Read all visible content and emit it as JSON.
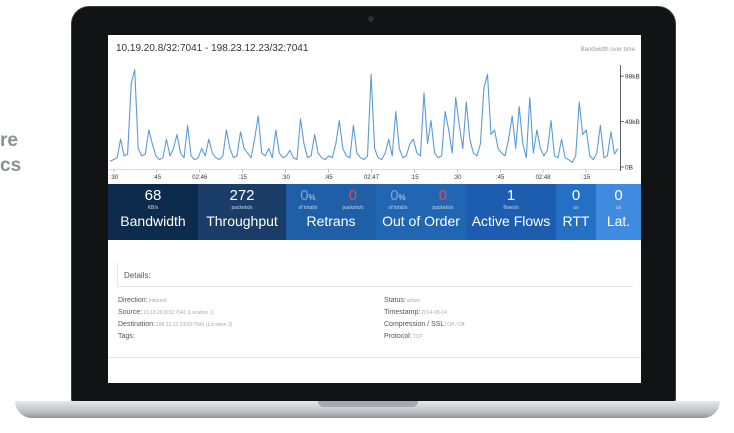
{
  "side_text": [
    "re",
    "cs"
  ],
  "header": {
    "connection": "10.19.20.8/32:7041 - 198.23.12.23/32:7041",
    "caption": "Bandwidth over time"
  },
  "chart_data": {
    "type": "line",
    "title": "Bandwidth over time",
    "x_tick_labels": [
      ":30",
      ":45",
      "02:46",
      ":15",
      ":30",
      ":45",
      "02:47",
      ":15",
      ":30",
      ":45",
      "02:48",
      ":15"
    ],
    "y_tick_labels": [
      "98kB",
      "49kB",
      "0B"
    ],
    "ylim": [
      0,
      110
    ],
    "y_unit": "kB",
    "series": [
      {
        "color": "#5b9bd9",
        "values": [
          6,
          8,
          10,
          30,
          12,
          14,
          90,
          105,
          20,
          12,
          14,
          40,
          25,
          12,
          8,
          10,
          30,
          12,
          20,
          35,
          15,
          10,
          45,
          12,
          8,
          10,
          20,
          12,
          30,
          15,
          10,
          8,
          12,
          40,
          20,
          10,
          12,
          38,
          20,
          15,
          10,
          30,
          55,
          15,
          12,
          20,
          10,
          40,
          15,
          10,
          12,
          18,
          10,
          8,
          52,
          25,
          10,
          12,
          35,
          15,
          10,
          8,
          12,
          10,
          25,
          50,
          20,
          12,
          10,
          45,
          15,
          10,
          8,
          12,
          100,
          20,
          10,
          8,
          15,
          30,
          12,
          60,
          20,
          10,
          12,
          25,
          30,
          15,
          12,
          80,
          25,
          50,
          15,
          10,
          12,
          60,
          40,
          15,
          75,
          45,
          20,
          70,
          30,
          15,
          12,
          25,
          85,
          100,
          35,
          40,
          20,
          15,
          12,
          30,
          55,
          20,
          65,
          25,
          10,
          75,
          15,
          40,
          20,
          12,
          18,
          50,
          12,
          10,
          30,
          10,
          8,
          5,
          12,
          70,
          35,
          40,
          12,
          8,
          15,
          45,
          10,
          12,
          38,
          14,
          20
        ]
      }
    ]
  },
  "metrics": {
    "bandwidth": {
      "value": "68",
      "unit": "KB/s",
      "label": "Bandwidth"
    },
    "throughput": {
      "value": "272",
      "unit": "packets/s",
      "label": "Throughput"
    },
    "retrans": {
      "value_a": "0",
      "unit_a_sym": "%",
      "unit_a": "of total/s",
      "value_b": "0",
      "unit_b": "packets/s",
      "label": "Retrans"
    },
    "out_of_order": {
      "value_a": "0",
      "unit_a_sym": "%",
      "unit_a": "of total/s",
      "value_b": "0",
      "unit_b": "packets/s",
      "label": "Out of Order"
    },
    "active_flows": {
      "value": "1",
      "unit": "flows/s",
      "label": "Active Flows"
    },
    "rtt": {
      "value": "0",
      "unit": "us",
      "label": "RTT"
    },
    "latency": {
      "value": "0",
      "unit": "us",
      "label": "Lat."
    }
  },
  "details": {
    "title": "Details:",
    "direction_label": "Direction:",
    "direction_value": "Inbound",
    "source_label": "Source:",
    "source_value": "10.19.20.8/32:7041 (Location 1)",
    "destination_label": "Destination:",
    "destination_value": "198.23.12.23/32:7041 (Location 2)",
    "tags_label": "Tags:",
    "status_label": "Status:",
    "status_value": "active",
    "timestamp_label": "Timestamp:",
    "timestamp_value": "2014-08-14",
    "compression_label": "Compression / SSL:",
    "compression_value": "Off / Off",
    "protocol_label": "Protocol:",
    "protocol_value": "TCP"
  }
}
